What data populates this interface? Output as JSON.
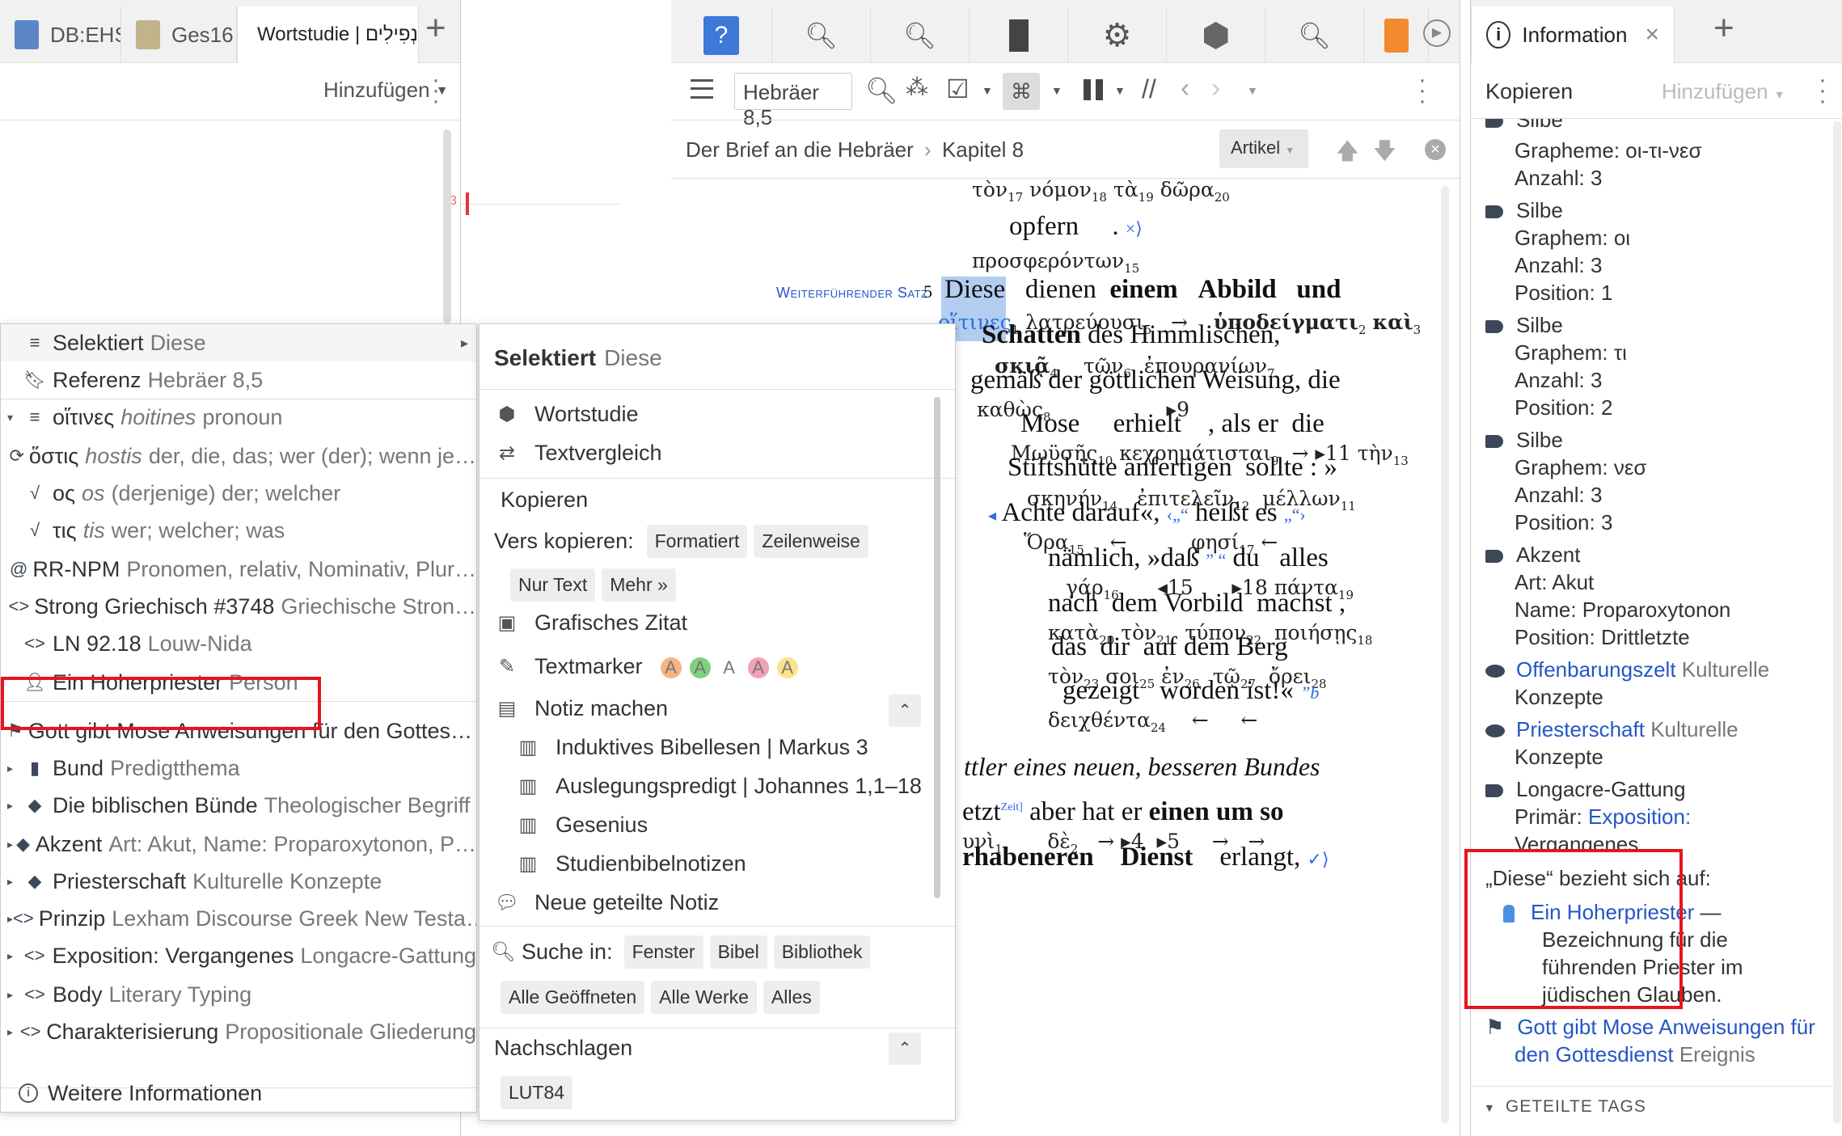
{
  "left_pane": {
    "tabs": [
      {
        "label": "DB:EHS",
        "color": "#5b87c9"
      },
      {
        "label": "Ges16",
        "color": "#c2b48a"
      },
      {
        "label": "Wortstudie | נְפִילִים",
        "color": "#3b4b61"
      }
    ],
    "add_label": "Hinzufügen",
    "chart_tick": "3"
  },
  "context_menu_left": {
    "items": [
      {
        "icon": "list-icon",
        "label": "Selektiert",
        "detail": "Diese",
        "arrow": "▸"
      },
      {
        "icon": "bookmark-icon",
        "label": "Referenz",
        "detail": "Hebräer 8,5"
      },
      {
        "icon": "list-icon",
        "label": "οἵτινες",
        "italic": "hoitines",
        "detail": "pronoun",
        "expander": "▾"
      },
      {
        "icon": "lemma-icon",
        "label": "ὅστις",
        "italic": "hostis",
        "detail": "der, die, das; wer (der); wenn je…"
      },
      {
        "icon": "root-icon",
        "label": "ος",
        "italic": "os",
        "detail": "(derjenige) der; welcher"
      },
      {
        "icon": "root-icon",
        "label": "τις",
        "italic": "tis",
        "detail": "wer; welcher; was"
      },
      {
        "icon": "at-icon",
        "label": "RR-NPM",
        "detail": "Pronomen, relativ, Nominativ, Plur…"
      },
      {
        "icon": "code-icon",
        "label": "Strong Griechisch #3748",
        "detail": "Griechische Stron…"
      },
      {
        "icon": "code-icon",
        "label": "LN 92.18",
        "detail": "Louw-Nida"
      },
      {
        "icon": "person-icon",
        "label": "Ein Hoherpriester",
        "detail": "Person"
      },
      {
        "icon": "flag-icon",
        "label": "Gott gibt Mose Anweisungen für den Gottes…",
        "detail": ""
      },
      {
        "icon": "book-icon",
        "label": "Bund",
        "detail": "Predigtthema",
        "expander": "▸"
      },
      {
        "icon": "tag-icon",
        "label": "Die biblischen Bünde",
        "detail": "Theologischer Begriff",
        "expander": "▸"
      },
      {
        "icon": "tag-icon",
        "label": "Akzent",
        "detail": "Art: Akut, Name: Proparoxytonon, P…",
        "expander": "▸"
      },
      {
        "icon": "tag-icon",
        "label": "Priesterschaft",
        "detail": "Kulturelle Konzepte",
        "expander": "▸"
      },
      {
        "icon": "code-icon",
        "label": "Prinzip",
        "detail": "Lexham Discourse Greek New Testa…",
        "expander": "▸"
      },
      {
        "icon": "code-icon",
        "label": "Exposition: Vergangenes",
        "detail": "Longacre-Gattung",
        "expander": "▸"
      },
      {
        "icon": "code-icon",
        "label": "Body",
        "detail": "Literary Typing",
        "expander": "▸"
      },
      {
        "icon": "code-icon",
        "label": "Charakterisierung",
        "detail": "Propositionale Gliederung",
        "expander": "▸"
      }
    ],
    "more_info": "Weitere Informationen"
  },
  "context_menu_right": {
    "header_label": "Selektiert",
    "header_detail": "Diese",
    "wortstudie": "Wortstudie",
    "textvergleich": "Textvergleich",
    "kopieren": "Kopieren",
    "vers_kopieren": "Vers kopieren:",
    "copy_chips_row1": [
      "Formatiert",
      "Zeilenweise"
    ],
    "copy_chips_row2": [
      "Nur Text",
      "Mehr »"
    ],
    "grafisches_zitat": "Grafisches Zitat",
    "textmarker": "Textmarker",
    "highlighters": [
      {
        "letter": "A",
        "color": "#f5b482"
      },
      {
        "letter": "A",
        "color": "#7fd17f"
      },
      {
        "letter": "A",
        "color": "#ffffff"
      },
      {
        "letter": "A",
        "color": "#f1a2b4"
      },
      {
        "letter": "A",
        "color": "#fbe38a"
      }
    ],
    "notiz_machen": "Notiz machen",
    "notes": [
      "Induktives Bibellesen | Markus 3",
      "Auslegungspredigt | Johannes 1,1–18",
      "Gesenius",
      "Studienbibelnotizen"
    ],
    "neue_notiz": "Neue geteilte Notiz",
    "suche_in": "Suche in:",
    "search_chips_row1": [
      "Fenster",
      "Bibel",
      "Bibliothek"
    ],
    "search_chips_row2": [
      "Alle Geöffneten",
      "Alle Werke",
      "Alles"
    ],
    "nachschlagen": "Nachschlagen",
    "lookup_chips": [
      "LUT84"
    ]
  },
  "middle_pane": {
    "reference": "Hebräer 8,5",
    "breadcrumb_book": "Der Brief an die Hebräer",
    "breadcrumb_chapter": "Kapitel 8",
    "artikel": "Artikel",
    "weiterfuehrender_satz": "Weiterführender Satz",
    "verse_number": "5",
    "marker_9": "▸9",
    "marker_15": "◂15",
    "marker_18": "▸18",
    "marker_11": "▸11",
    "marker_4": "▸4",
    "marker_5": "▸5",
    "footnote_b": "b",
    "zeit_tag": "Zeit]",
    "section_heading": "ttler eines neuen, besseren Bundes"
  },
  "right_pane": {
    "tab_label": "Information",
    "kopieren": "Kopieren",
    "add_label": "Hinzufügen",
    "cut_top_label": "Silbe",
    "grapheme_line": "Grapheme: οι-τι-νεσ",
    "grapheme_count": "Anzahl: 3",
    "silbe_blocks": [
      {
        "title": "Silbe",
        "graph": "Graphem: οι",
        "count": "Anzahl: 3",
        "pos": "Position: 1"
      },
      {
        "title": "Silbe",
        "graph": "Graphem: τι",
        "count": "Anzahl: 3",
        "pos": "Position: 2"
      },
      {
        "title": "Silbe",
        "graph": "Graphem: νεσ",
        "count": "Anzahl: 3",
        "pos": "Position: 3"
      }
    ],
    "akzent_title": "Akzent",
    "akzent_lines": [
      "Art: Akut",
      "Name: Proparoxytonon",
      "Position: Drittletzte"
    ],
    "offenbarungszelt_link": "Offenbarungszelt",
    "offenbarungszelt_detail": "Kulturelle",
    "offenbarungszelt_detail2": "Konzepte",
    "priesterschaft_link": "Priesterschaft",
    "priesterschaft_detail": "Kulturelle",
    "priesterschaft_detail2": "Konzepte",
    "longacre_title": "Longacre-Gattung",
    "longacre_primaer": "Primär:",
    "longacre_link": "Exposition:",
    "longacre_link2": "Vergangenes",
    "bezieht_label": "„Diese“ bezieht sich auf:",
    "hoherpriester_link": "Ein Hoherpriester",
    "hoherpriester_dash": " —",
    "hoherpriester_desc": [
      "Bezeichnung für die",
      "führenden Priester im",
      "jüdischen Glauben."
    ],
    "gott_link_1": "Gott gibt Mose Anweisungen für",
    "gott_link_2": "den Gottesdienst",
    "gott_detail": "Ereignis",
    "geteilte_tags": "GETEILTE TAGS"
  }
}
